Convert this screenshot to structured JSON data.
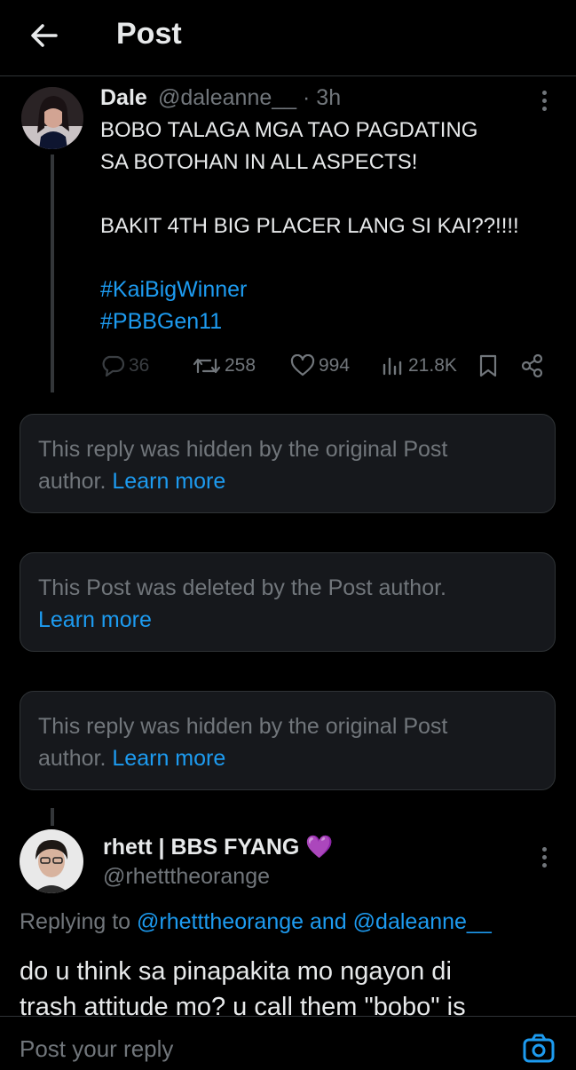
{
  "header": {
    "title": "Post",
    "back_icon": "arrow-left-icon"
  },
  "original_post": {
    "author_name": "Dale",
    "handle_time": "@daleanne__ · 3h",
    "text_lines": [
      "BOBO TALAGA MGA TAO PAGDATING",
      "SA BOTOHAN IN ALL ASPECTS!",
      "",
      "BAKIT 4TH BIG PLACER LANG SI KAI??!!!!"
    ],
    "hashtags": [
      "#KaiBigWinner",
      "#PBBGen11"
    ],
    "stats": {
      "replies": "36",
      "reposts": "258",
      "likes": "994",
      "views": "21.8K"
    }
  },
  "notices": [
    {
      "text": "This reply was hidden by the original Post",
      "text2": "author.",
      "link": "Learn more"
    },
    {
      "text": "This Post was deleted by the Post author.",
      "link": "Learn more"
    },
    {
      "text": "This reply was hidden by the original Post",
      "text2": "author.",
      "link": "Learn more"
    }
  ],
  "reply": {
    "author_name": "rhett | BBS FYANG",
    "badge_emoji": "💜",
    "handle": "@rhetttheorange",
    "replying_prefix": "Replying to",
    "mention1": "@rhetttheorange",
    "and_word": "and",
    "mention2": "@daleanne__",
    "body_line1": "do u think sa pinapakita mo ngayon di",
    "body_line2": "trash attitude mo? u call them \"bobo\" is"
  },
  "composer": {
    "placeholder": "Post your reply",
    "camera_icon": "camera-icon"
  },
  "colors": {
    "background": "#000000",
    "accent": "#1d9bf0",
    "muted": "#71767b",
    "card": "#16181c"
  }
}
